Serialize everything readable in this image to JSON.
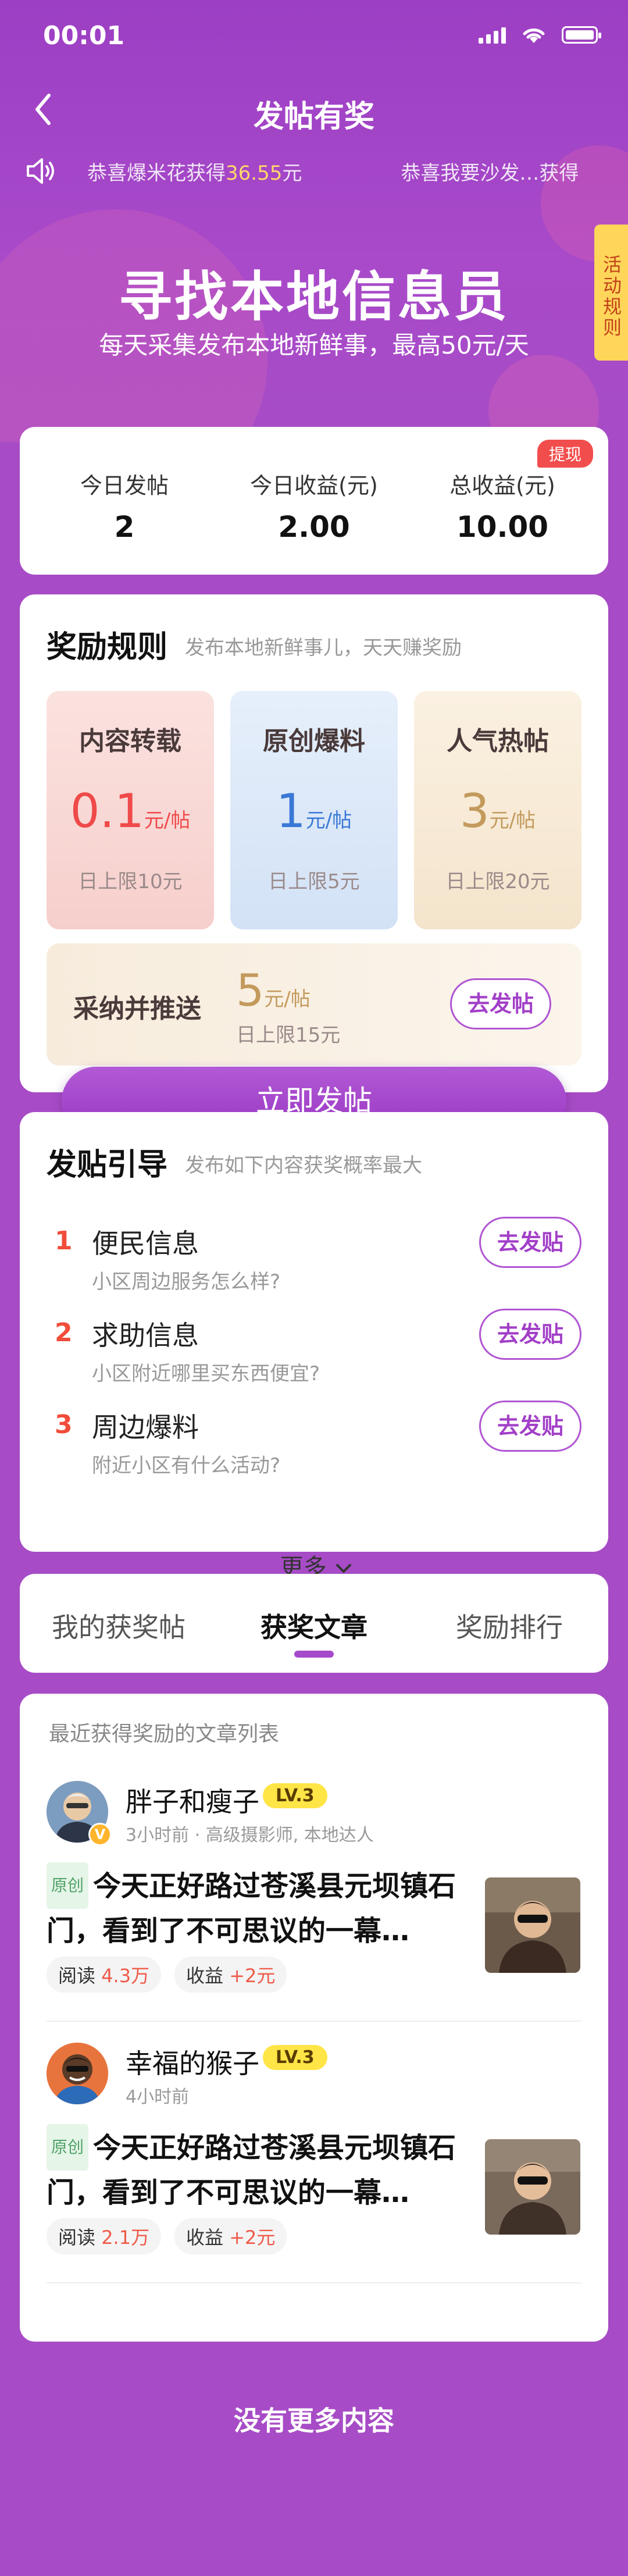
{
  "status": {
    "time": "00:01"
  },
  "nav": {
    "title": "发帖有奖"
  },
  "ticker": {
    "items": [
      {
        "prefix": "恭喜爆米花获得",
        "amount": "36.55",
        "suffix": "元"
      },
      {
        "text": "恭喜我要沙发…获得"
      }
    ]
  },
  "activity_tab": {
    "label": "活动规则"
  },
  "hero": {
    "title": "寻找本地信息员",
    "subtitle": "每天采集发布本地新鲜事，最高50元/天"
  },
  "stats": {
    "withdraw_label": "提现",
    "items": [
      {
        "label": "今日发帖",
        "value": "2"
      },
      {
        "label": "今日收益(元)",
        "value": "2.00"
      },
      {
        "label": "总收益(元)",
        "value": "10.00"
      }
    ]
  },
  "rules": {
    "title": "奖励规则",
    "hint": "发布本地新鲜事儿，天天赚奖励",
    "boxes": [
      {
        "name": "内容转载",
        "value": "0.1",
        "unit": "元/帖",
        "limit": "日上限10元",
        "color": "#ef4a4a"
      },
      {
        "name": "原创爆料",
        "value": "1",
        "unit": "元/帖",
        "limit": "日上限5元",
        "color": "#3a78d6"
      },
      {
        "name": "人气热帖",
        "value": "3",
        "unit": "元/帖",
        "limit": "日上限20元",
        "color": "#c39a5c"
      }
    ],
    "wide": {
      "name": "采纳并推送",
      "value": "5",
      "unit": "元/帖",
      "limit": "日上限15元",
      "button": "去发帖"
    }
  },
  "post_now": {
    "label": "立即发帖"
  },
  "guide": {
    "title": "发贴引导",
    "hint": "发布如下内容获奖概率最大",
    "items": [
      {
        "num": "1",
        "title": "便民信息",
        "sub": "小区周边服务怎么样?",
        "button": "去发贴"
      },
      {
        "num": "2",
        "title": "求助信息",
        "sub": "小区附近哪里买东西便宜?",
        "button": "去发贴"
      },
      {
        "num": "3",
        "title": "周边爆料",
        "sub": "附近小区有什么活动?",
        "button": "去发贴"
      }
    ],
    "more": "更多"
  },
  "tabs": {
    "items": [
      "我的获奖帖",
      "获奖文章",
      "奖励排行"
    ],
    "active": 1
  },
  "list": {
    "caption": "最近获得奖励的文章列表",
    "articles": [
      {
        "author": "胖子和瘦子",
        "level": "LV.3",
        "meta": "3小时前 · 高级摄影师, 本地达人",
        "tag": "原创",
        "title": "今天正好路过苍溪县元坝镇石门，看到了不可思议的一幕…",
        "read_label": "阅读",
        "read_value": "4.3万",
        "income_label": "收益",
        "income_value": "+2元"
      },
      {
        "author": "幸福的猴子",
        "level": "LV.3",
        "meta": "4小时前",
        "tag": "原创",
        "title": "今天正好路过苍溪县元坝镇石门，看到了不可思议的一幕…",
        "read_label": "阅读",
        "read_value": "2.1万",
        "income_label": "收益",
        "income_value": "+2元"
      }
    ]
  },
  "footer": {
    "text": "没有更多内容"
  },
  "colors": {
    "bg": "#a74cc6",
    "accent": "#a54acb",
    "red": "#ef4a4a",
    "badge": "#ffe546"
  }
}
